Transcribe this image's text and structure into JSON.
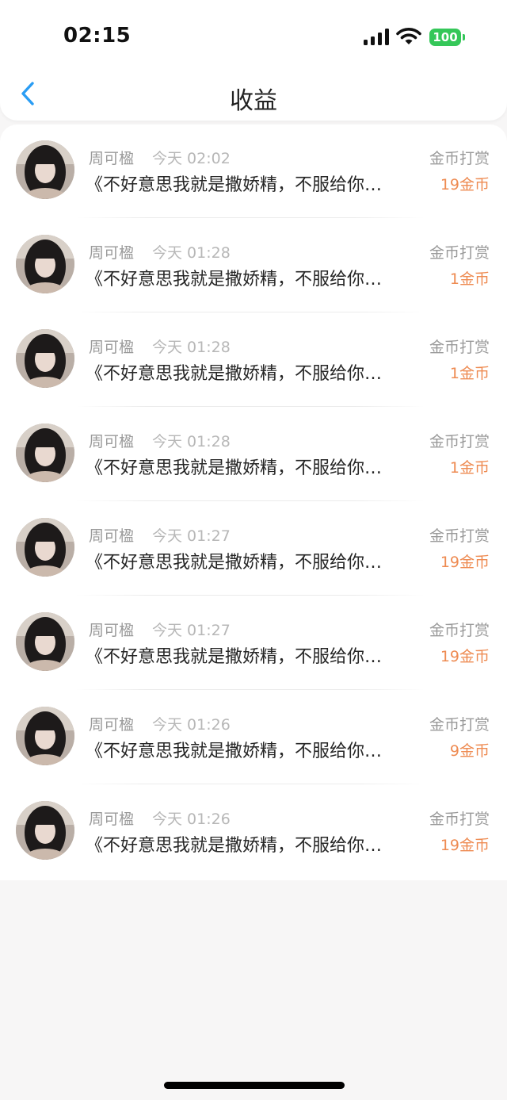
{
  "status_bar": {
    "time": "02:15",
    "battery": "100",
    "battery_color": "#35c759"
  },
  "nav": {
    "title": "收益",
    "back_icon": "chevron-left-icon",
    "accent": "#2a9df4"
  },
  "items": [
    {
      "name": "周可楹",
      "time": "今天 02:02",
      "title": "《不好意思我就是撒娇精，不服给你…",
      "type": "金币打赏",
      "amount": "19金币"
    },
    {
      "name": "周可楹",
      "time": "今天 01:28",
      "title": "《不好意思我就是撒娇精，不服给你…",
      "type": "金币打赏",
      "amount": "1金币"
    },
    {
      "name": "周可楹",
      "time": "今天 01:28",
      "title": "《不好意思我就是撒娇精，不服给你…",
      "type": "金币打赏",
      "amount": "1金币"
    },
    {
      "name": "周可楹",
      "time": "今天 01:28",
      "title": "《不好意思我就是撒娇精，不服给你…",
      "type": "金币打赏",
      "amount": "1金币"
    },
    {
      "name": "周可楹",
      "time": "今天 01:27",
      "title": "《不好意思我就是撒娇精，不服给你…",
      "type": "金币打赏",
      "amount": "19金币"
    },
    {
      "name": "周可楹",
      "time": "今天 01:27",
      "title": "《不好意思我就是撒娇精，不服给你…",
      "type": "金币打赏",
      "amount": "19金币"
    },
    {
      "name": "周可楹",
      "time": "今天 01:26",
      "title": "《不好意思我就是撒娇精，不服给你…",
      "type": "金币打赏",
      "amount": "9金币"
    },
    {
      "name": "周可楹",
      "time": "今天 01:26",
      "title": "《不好意思我就是撒娇精，不服给你…",
      "type": "金币打赏",
      "amount": "19金币"
    }
  ],
  "colors": {
    "amount": "#ee8b52",
    "secondary_text": "#9a9a9a",
    "primary_text": "#262626"
  }
}
